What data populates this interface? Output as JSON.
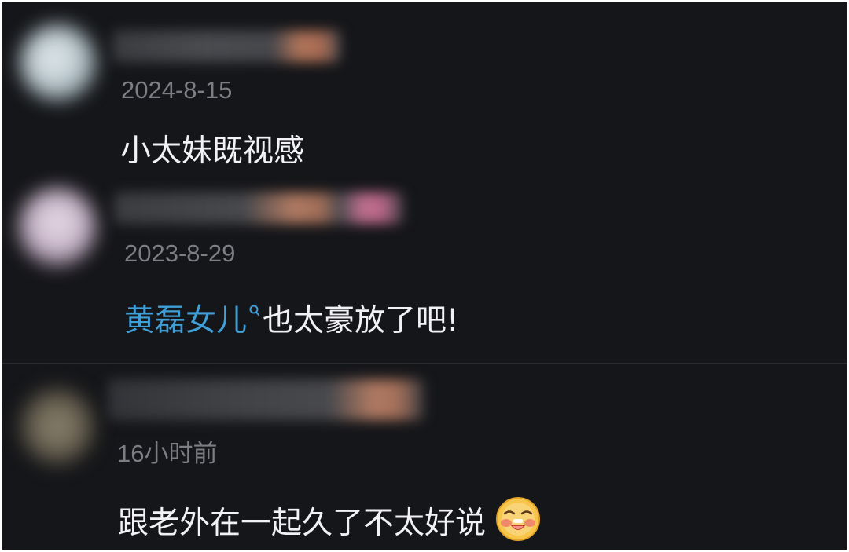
{
  "comments": [
    {
      "date": "2024-8-15",
      "text": "小太妹既视感"
    },
    {
      "date": "2023-8-29",
      "mention": "黄磊女儿",
      "mention_icon": "search-icon",
      "text": "也太豪放了吧!"
    },
    {
      "date": "16小时前",
      "text": "跟老外在一起久了不太好说",
      "emoji": "grinning-blush-emoji"
    }
  ],
  "colors": {
    "background": "#151619",
    "text": "#f2f2f4",
    "date": "#7c7e83",
    "mention": "#3f9fd6",
    "divider": "#2b2c30"
  }
}
